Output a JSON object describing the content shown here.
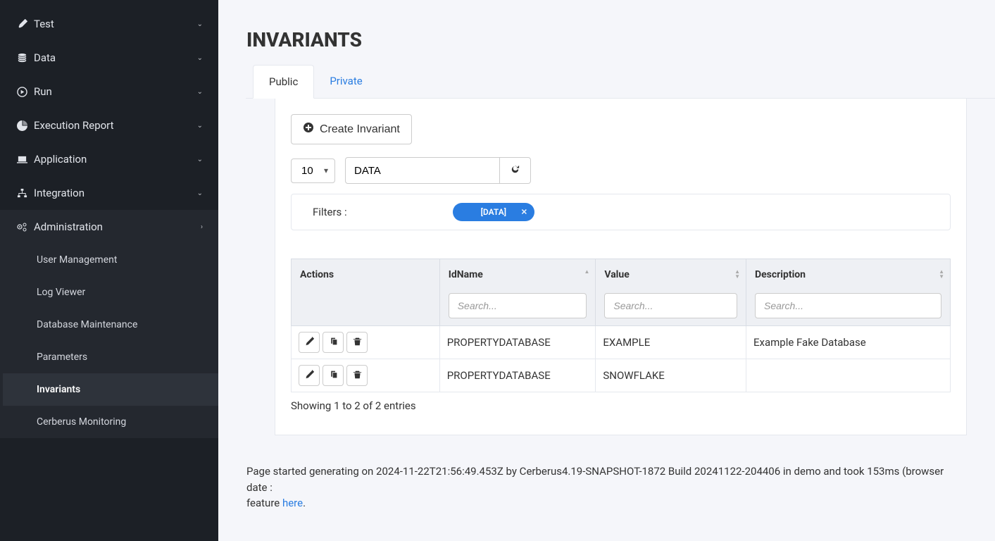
{
  "sidebar": {
    "items": [
      {
        "icon": "✎",
        "label": "Test"
      },
      {
        "icon": "≡",
        "label": "Data"
      },
      {
        "icon": "▶",
        "label": "Run"
      },
      {
        "icon": "◔",
        "label": "Execution Report"
      },
      {
        "icon": "🖵",
        "label": "Application"
      },
      {
        "icon": "⚙",
        "label": "Integration"
      }
    ],
    "admin": {
      "label": "Administration",
      "icon": "⚙⚙",
      "sub": [
        {
          "label": "User Management"
        },
        {
          "label": "Log Viewer"
        },
        {
          "label": "Database Maintenance"
        },
        {
          "label": "Parameters"
        },
        {
          "label": "Invariants",
          "active": true
        },
        {
          "label": "Cerberus Monitoring"
        }
      ]
    }
  },
  "page": {
    "title": "INVARIANTS"
  },
  "tabs": {
    "public": "Public",
    "private": "Private"
  },
  "toolbar": {
    "create_label": "Create Invariant",
    "page_size": "10",
    "search_value": "DATA"
  },
  "filters": {
    "label": "Filters :",
    "chip": "[DATA]"
  },
  "table": {
    "columns": {
      "actions": "Actions",
      "idname": "IdName",
      "value": "Value",
      "description": "Description"
    },
    "search_placeholder": "Search...",
    "rows": [
      {
        "idname": "PROPERTYDATABASE",
        "value": "EXAMPLE",
        "description": "Example Fake Database"
      },
      {
        "idname": "PROPERTYDATABASE",
        "value": "SNOWFLAKE",
        "description": ""
      }
    ],
    "info": "Showing 1 to 2 of 2 entries"
  },
  "footer": {
    "text_prefix": "Page started generating on 2024-11-22T21:56:49.453Z by Cerberus4.19-SNAPSHOT-1872 Build 20241122-204406 in demo and took 153ms (browser date : ",
    "text_feature": "feature ",
    "here": "here",
    "dot": "."
  }
}
